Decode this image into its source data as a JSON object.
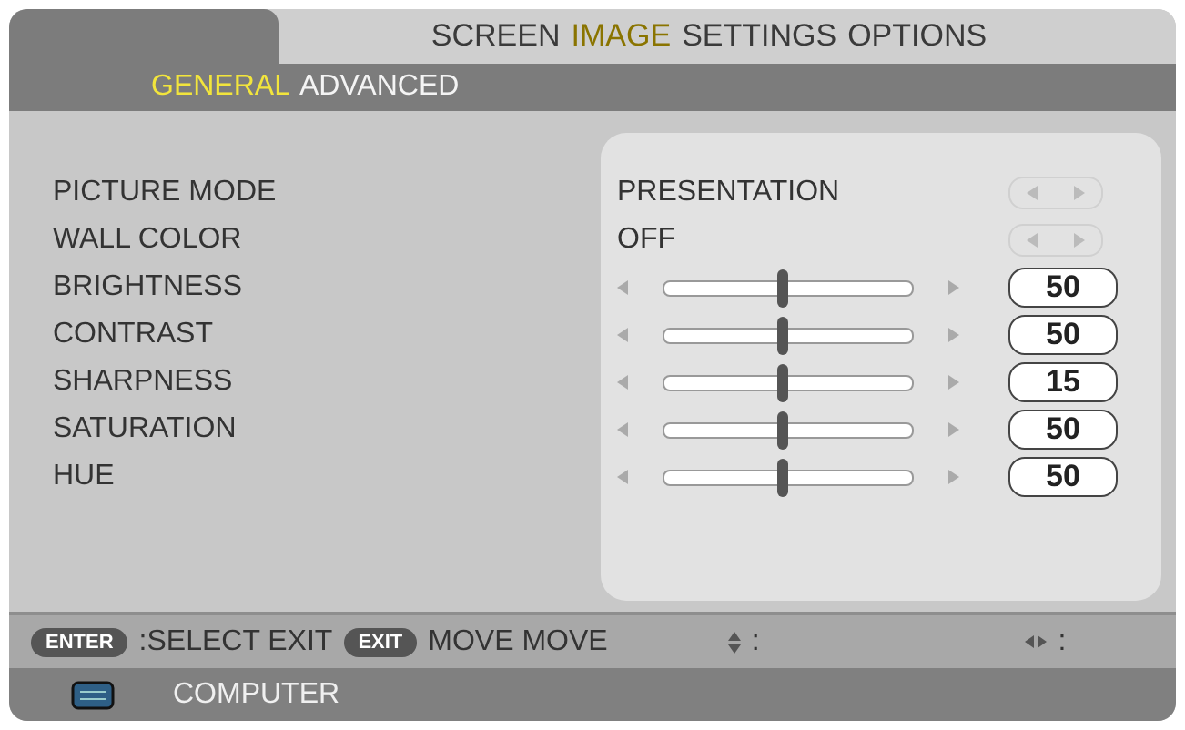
{
  "menu_tabs": [
    {
      "label": "SCREEN",
      "selected": false
    },
    {
      "label": "IMAGE",
      "selected": true
    },
    {
      "label": "SETTINGS",
      "selected": false
    },
    {
      "label": "OPTIONS",
      "selected": false
    }
  ],
  "sub_tabs": [
    {
      "label": "GENERAL",
      "selected": true
    },
    {
      "label": "ADVANCED",
      "selected": false
    }
  ],
  "settings": [
    {
      "kind": "select",
      "label": "PICTURE MODE",
      "value": "PRESENTATION"
    },
    {
      "kind": "select",
      "label": "WALL COLOR",
      "value": "OFF"
    },
    {
      "kind": "slider",
      "label": "BRIGHTNESS",
      "level": 0.48,
      "value": "50"
    },
    {
      "kind": "slider",
      "label": "CONTRAST",
      "level": 0.48,
      "value": "50"
    },
    {
      "kind": "slider",
      "label": "SHARPNESS",
      "level": 0.48,
      "value": "15"
    },
    {
      "kind": "slider",
      "label": "SATURATION",
      "level": 0.48,
      "value": "50"
    },
    {
      "kind": "slider",
      "label": "HUE",
      "level": 0.48,
      "value": "50"
    }
  ],
  "footer": [
    {
      "kind": "key",
      "text": "ENTER"
    },
    {
      "kind": "text",
      "text": ":SELECT EXIT"
    },
    {
      "kind": "key",
      "text": "EXIT"
    },
    {
      "kind": "text",
      "text": "MOVE MOVE"
    },
    {
      "kind": "updown",
      "text": ":"
    },
    {
      "kind": "leftright",
      "text": ":"
    }
  ],
  "input": {
    "label": "COMPUTER"
  }
}
